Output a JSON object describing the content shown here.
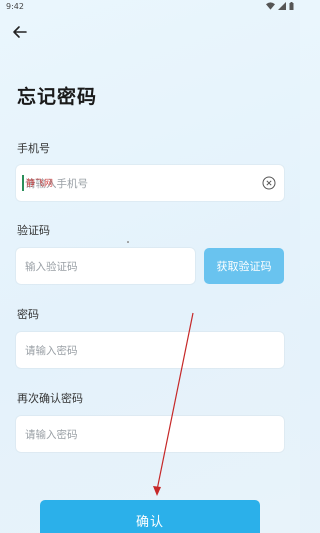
{
  "status": {
    "time": "9:42"
  },
  "header": {
    "title": "忘记密码"
  },
  "form": {
    "phone": {
      "label": "手机号",
      "placeholder": "请输入手机号"
    },
    "code": {
      "label": "验证码",
      "placeholder": "输入验证码",
      "button": "获取验证码"
    },
    "password": {
      "label": "密码",
      "placeholder": "请输入密码"
    },
    "confirm_password": {
      "label": "再次确认密码",
      "placeholder": "请输入密码"
    }
  },
  "confirm_button": "确认",
  "watermark": "静飞网",
  "colors": {
    "accent": "#2bb0ea",
    "code_button": "#69c3ef",
    "annotation": "#c62828"
  },
  "icons": {
    "back": "arrow-left-icon",
    "clear": "clear-circle-icon"
  }
}
